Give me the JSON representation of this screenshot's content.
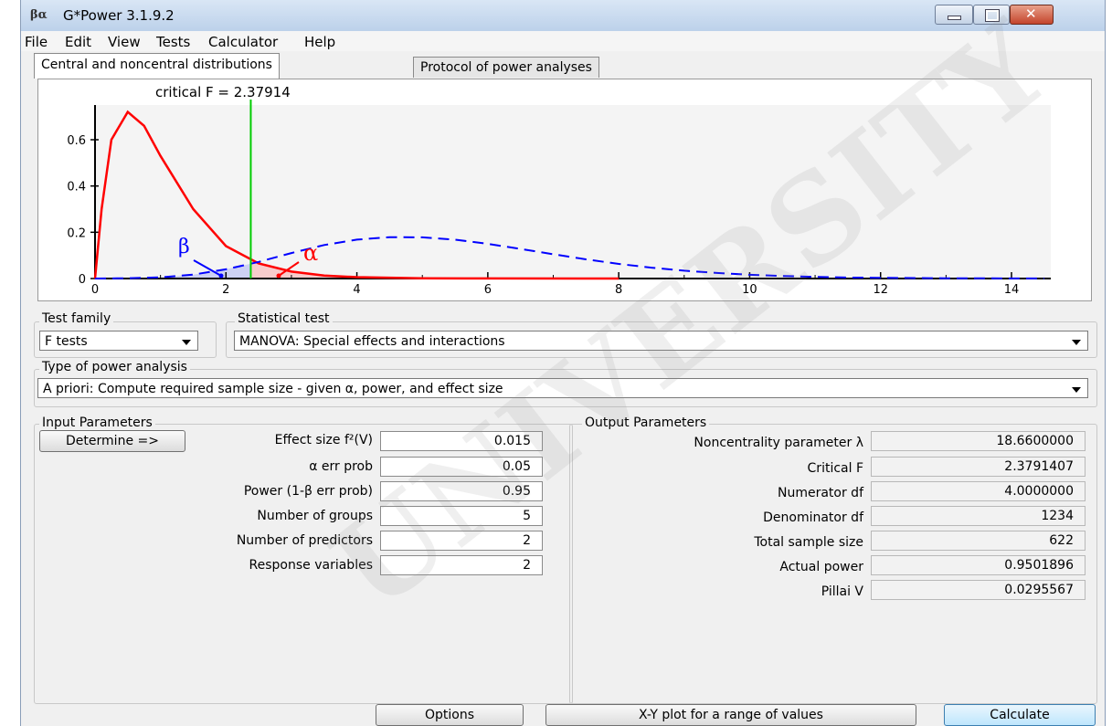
{
  "window": {
    "title": "G*Power 3.1.9.2",
    "icon_text": "βα"
  },
  "menu": [
    "File",
    "Edit",
    "View",
    "Tests",
    "Calculator",
    "Help"
  ],
  "tabs": [
    "Central and noncentral distributions",
    "Protocol of power analyses"
  ],
  "plot": {
    "critical_label": "critical F = 2.37914",
    "x_ticks": [
      "0",
      "2",
      "4",
      "6",
      "8",
      "10",
      "12",
      "14"
    ],
    "y_ticks": [
      "0",
      "0.2",
      "0.4",
      "0.6"
    ],
    "beta_label": "β",
    "alpha_label": "α",
    "colors": {
      "central": "#ff0000",
      "noncentral": "#0000ff",
      "critical": "#00cc00"
    }
  },
  "chart_data": {
    "type": "line",
    "title": "",
    "xlabel": "",
    "ylabel": "",
    "xlim": [
      0,
      14.6
    ],
    "ylim": [
      0,
      0.75
    ],
    "critical_F": 2.37914,
    "series": [
      {
        "style": "solid",
        "color": "#ff0000",
        "x": [
          0,
          0.1,
          0.25,
          0.5,
          0.75,
          1,
          1.5,
          2,
          2.5,
          3,
          3.5,
          4,
          5,
          6,
          8
        ],
        "y": [
          0,
          0.3,
          0.6,
          0.72,
          0.66,
          0.53,
          0.3,
          0.14,
          0.065,
          0.03,
          0.013,
          0.006,
          0.001,
          0.0002,
          0
        ]
      },
      {
        "style": "dashed",
        "color": "#0000ff",
        "x": [
          0,
          0.5,
          1,
          1.5,
          2,
          2.5,
          3,
          3.5,
          4,
          4.5,
          5,
          5.5,
          6,
          6.5,
          7,
          7.5,
          8,
          8.5,
          9,
          9.5,
          10,
          10.5,
          11,
          11.5,
          12,
          13,
          14.5
        ],
        "y": [
          0,
          0.001,
          0.005,
          0.017,
          0.04,
          0.072,
          0.11,
          0.145,
          0.168,
          0.179,
          0.178,
          0.168,
          0.15,
          0.128,
          0.105,
          0.083,
          0.063,
          0.047,
          0.034,
          0.024,
          0.016,
          0.011,
          0.007,
          0.0045,
          0.003,
          0.001,
          0.0002
        ]
      }
    ]
  },
  "test_family": {
    "label": "Test family",
    "value": "F tests"
  },
  "statistical_test": {
    "label": "Statistical test",
    "value": "MANOVA: Special effects and interactions"
  },
  "power_analysis": {
    "label": "Type of power analysis",
    "value": "A priori: Compute required sample size - given α, power, and effect size"
  },
  "input": {
    "title": "Input Parameters",
    "determine_label": "Determine =>",
    "params": [
      {
        "label": "Effect size f²(V)",
        "value": "0.015"
      },
      {
        "label": "α err prob",
        "value": "0.05"
      },
      {
        "label": "Power (1-β err prob)",
        "value": "0.95"
      },
      {
        "label": "Number of groups",
        "value": "5"
      },
      {
        "label": "Number of predictors",
        "value": "2"
      },
      {
        "label": "Response variables",
        "value": "2"
      }
    ]
  },
  "output": {
    "title": "Output Parameters",
    "params": [
      {
        "label": "Noncentrality parameter λ",
        "value": "18.6600000"
      },
      {
        "label": "Critical F",
        "value": "2.3791407"
      },
      {
        "label": "Numerator df",
        "value": "4.0000000"
      },
      {
        "label": "Denominator df",
        "value": "1234"
      },
      {
        "label": "Total sample size",
        "value": "622"
      },
      {
        "label": "Actual power",
        "value": "0.9501896"
      },
      {
        "label": "Pillai V",
        "value": "0.0295567"
      }
    ]
  },
  "buttons": {
    "options": "Options",
    "xy_plot": "X-Y plot for a range of values",
    "calculate": "Calculate"
  }
}
